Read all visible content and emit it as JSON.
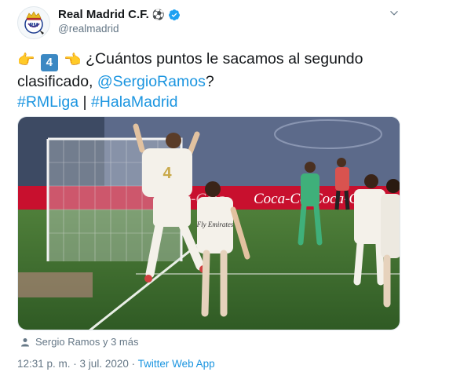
{
  "account": {
    "display_name": "Real Madrid C.F.",
    "name_emoji": "⚽",
    "handle": "@realmadrid",
    "verified": true,
    "avatar": "real-madrid-crest"
  },
  "tweet": {
    "lead_emoji_left": "👉",
    "keycap": "4",
    "lead_emoji_right": "👈",
    "text_part1": "¿Cuántos puntos le sacamos al segundo clasificado, ",
    "mention": "@SergioRamos",
    "text_part2": "?",
    "hashtag1": "#RMLiga",
    "separator": " | ",
    "hashtag2": "#HalaMadrid"
  },
  "media": {
    "description_icon": "football-celebration-photo",
    "banner_text": "Coca-Cola",
    "shirt_text": "Fly Emirates",
    "jersey_number": "4"
  },
  "tagged": {
    "label": "Sergio Ramos y 3 más"
  },
  "meta": {
    "time": "12:31 p. m.",
    "dot1": " · ",
    "date": "3 jul. 2020",
    "dot2": " · ",
    "source": "Twitter Web App"
  },
  "colors": {
    "link": "#1b95e0",
    "secondary_text": "#657786",
    "verified": "#1da1f2",
    "keycap": "#3b88c3"
  }
}
